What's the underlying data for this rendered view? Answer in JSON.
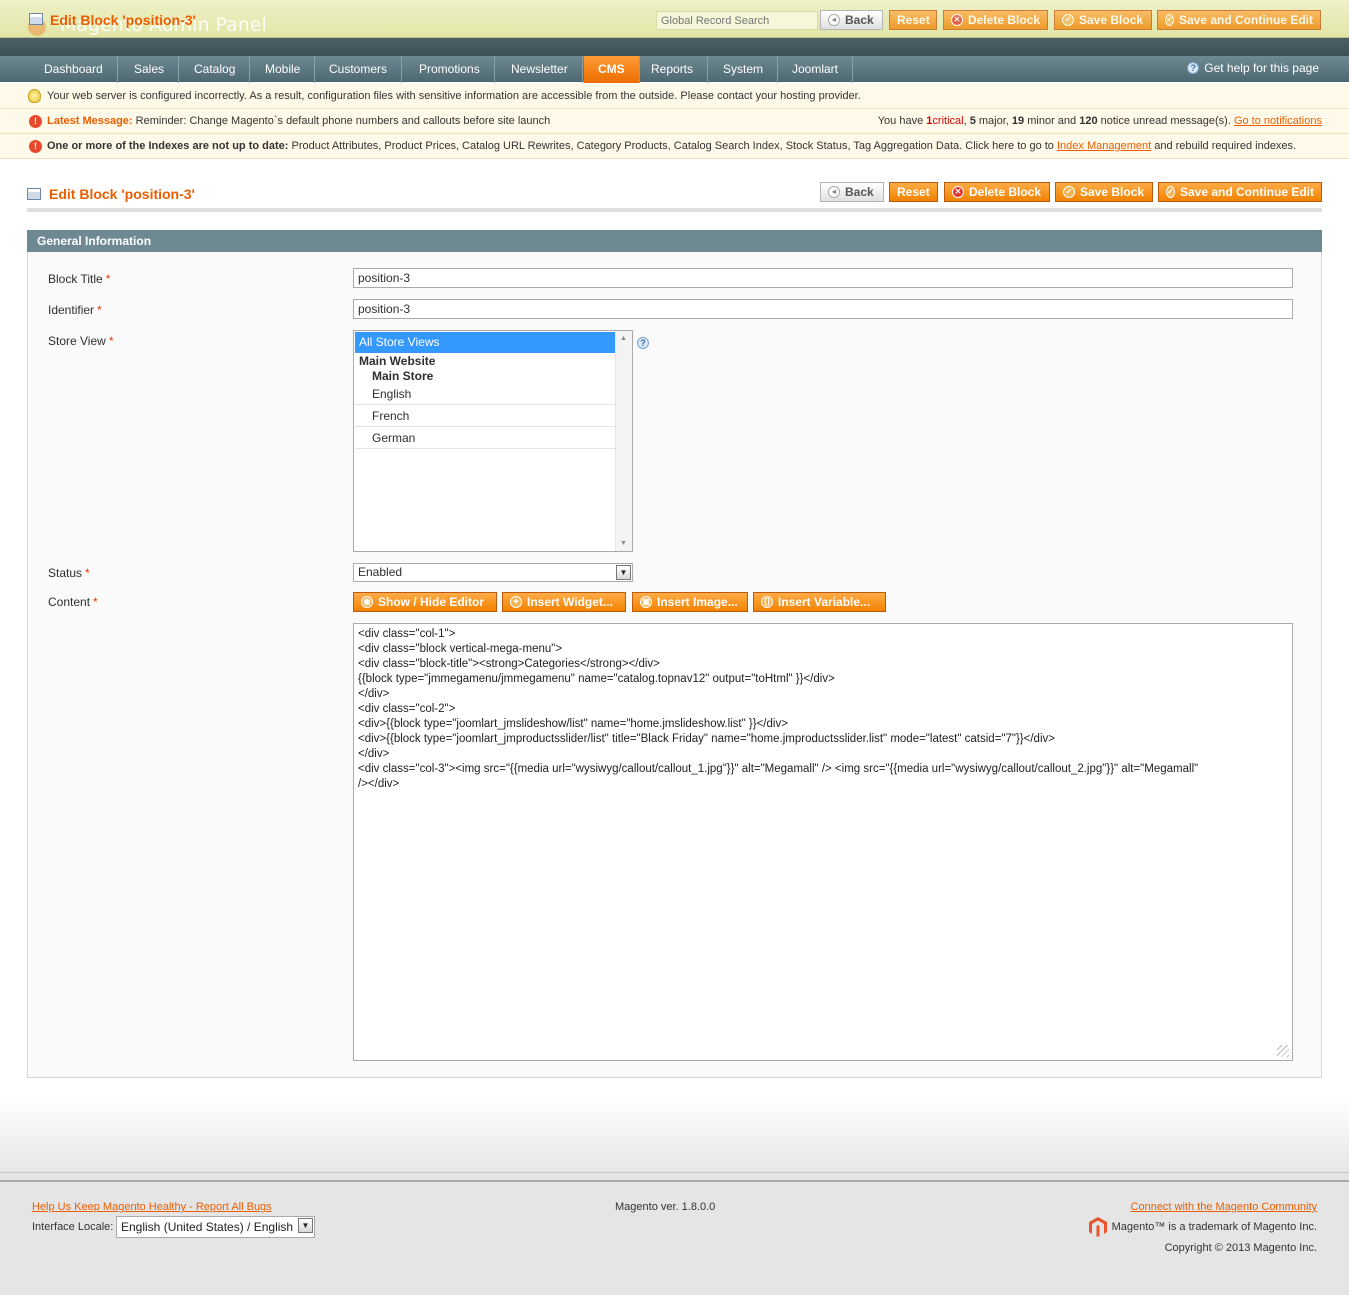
{
  "header": {
    "logo_text": "Magento Admin Panel",
    "floating_title": "Edit Block 'position-3'",
    "search_placeholder": "Global Record Search"
  },
  "buttons": {
    "back": "Back",
    "reset": "Reset",
    "delete": "Delete Block",
    "save": "Save Block",
    "save_continue": "Save and Continue Edit"
  },
  "nav": {
    "items": [
      "Dashboard",
      "Sales",
      "Catalog",
      "Mobile",
      "Customers",
      "Promotions",
      "Newsletter",
      "CMS",
      "Reports",
      "System",
      "Joomlart"
    ],
    "active": "CMS",
    "help": "Get help for this page"
  },
  "messages": {
    "config_warning": "Your web server is configured incorrectly. As a result, configuration files with sensitive information are accessible from the outside. Please contact your hosting provider.",
    "latest_label": "Latest Message:",
    "latest_text": "Reminder: Change Magento`s default phone numbers and callouts before site launch",
    "notice_prefix": "You have",
    "critical_count": "1",
    "critical_label": "critical",
    "major_count": "5",
    "major_label": "major,",
    "minor_count": "19",
    "minor_label": "minor and",
    "notice_count": "120",
    "notice_label": "notice unread message(s).",
    "notifications_link": "Go to notifications",
    "index_label": "One or more of the Indexes are not up to date:",
    "index_text": "Product Attributes, Product Prices, Catalog URL Rewrites, Category Products, Catalog Search Index, Stock Status, Tag Aggregation Data. Click here to go to",
    "index_link": "Index Management",
    "index_suffix": "and rebuild required indexes."
  },
  "page": {
    "title": "Edit Block 'position-3'"
  },
  "form": {
    "section_title": "General Information",
    "block_title_label": "Block Title",
    "block_title_value": "position-3",
    "identifier_label": "Identifier",
    "identifier_value": "position-3",
    "store_view_label": "Store View",
    "store_options": {
      "all": "All Store Views",
      "website": "Main Website",
      "store": "Main Store",
      "views": [
        "English",
        "French",
        "German"
      ]
    },
    "status_label": "Status",
    "status_value": "Enabled",
    "content_label": "Content",
    "required_mark": "*",
    "editor_buttons": {
      "show_hide": "Show / Hide Editor",
      "widget": "Insert Widget...",
      "image": "Insert Image...",
      "variable": "Insert Variable..."
    },
    "content_value": "<div class=\"col-1\">\n<div class=\"block vertical-mega-menu\">\n<div class=\"block-title\"><strong>Categories</strong></div>\n{{block type=\"jmmegamenu/jmmegamenu\" name=\"catalog.topnav12\" output=\"toHtml\" }}</div>\n</div>\n<div class=\"col-2\">\n<div>{{block type=\"joomlart_jmslideshow/list\" name=\"home.jmslideshow.list\" }}</div>\n<div>{{block type=\"joomlart_jmproductsslider/list\" title=\"Black Friday\" name=\"home.jmproductsslider.list\" mode=\"latest\" catsid=\"7\"}}</div>\n</div>\n<div class=\"col-3\"><img src=\"{{media url=\"wysiwyg/callout/callout_1.jpg\"}}\" alt=\"Megamall\" /> <img src=\"{{media url=\"wysiwyg/callout/callout_2.jpg\"}}\" alt=\"Megamall\"\n/></div>"
  },
  "footer": {
    "report_bugs": "Help Us Keep Magento Healthy - Report All Bugs",
    "locale_label": "Interface Locale:",
    "locale_value": "English (United States) / English",
    "version": "Magento ver. 1.8.0.0",
    "community": "Connect with the Magento Community",
    "trademark": "Magento™ is a trademark of Magento Inc.",
    "copyright": "Copyright © 2013 Magento Inc."
  },
  "colors": {
    "accent": "#eb5e00",
    "nav_bg": "#6f8992",
    "button": "#f18200",
    "selection": "#3399ff"
  }
}
